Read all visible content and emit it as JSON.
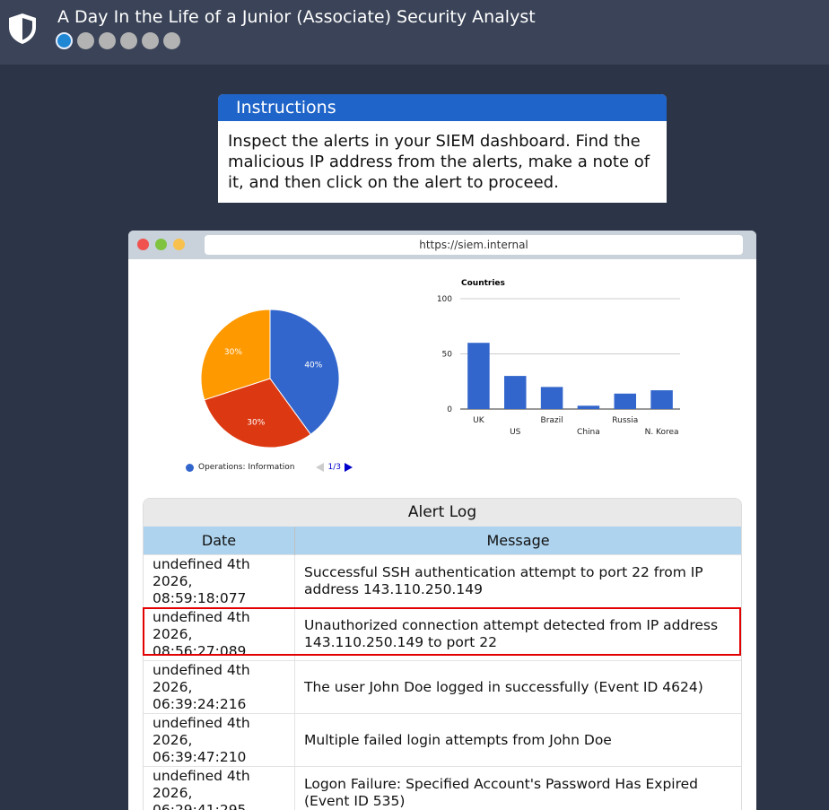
{
  "header": {
    "title": "A Day In the Life of a Junior (Associate) Security Analyst",
    "logo_icon": "shield-icon",
    "progress": {
      "total_steps": 6,
      "current_step": 1
    }
  },
  "instructions": {
    "heading": "Instructions",
    "body": "Inspect the alerts in your SIEM dashboard. Find the malicious IP address from the alerts, make a note of it, and then click on the alert to proceed."
  },
  "browser": {
    "url": "https://siem.internal"
  },
  "chart_data": [
    {
      "type": "pie",
      "slices": [
        {
          "label": "40%",
          "value": 40,
          "color": "#3366cc"
        },
        {
          "label": "30%",
          "value": 30,
          "color": "#dc3912"
        },
        {
          "label": "30%",
          "value": 30,
          "color": "#ff9900"
        }
      ],
      "legend": {
        "entry": "Operations: Information",
        "page": "1/3",
        "placement": "bottom"
      }
    },
    {
      "type": "bar",
      "title": "Countries",
      "categories": [
        "UK",
        "US",
        "Brazil",
        "China",
        "Russia",
        "N. Korea"
      ],
      "values": [
        60,
        30,
        20,
        3,
        14,
        17
      ],
      "ylim": [
        0,
        100
      ],
      "yticks": [
        "0",
        "50",
        "100"
      ],
      "grid": true,
      "color": "#3366cc"
    }
  ],
  "alert_log": {
    "title": "Alert Log",
    "columns": [
      "Date",
      "Message"
    ],
    "rows": [
      {
        "date": "undefined 4th 2026, 08:59:18:077",
        "message": "Successful SSH authentication attempt to port 22 from IP address 143.110.250.149"
      },
      {
        "date": "undefined 4th 2026, 08:56:27:089",
        "message": "Unauthorized connection attempt detected from IP address 143.110.250.149 to port 22"
      },
      {
        "date": "undefined 4th 2026, 06:39:24:216",
        "message": "The user John Doe logged in successfully (Event ID 4624)"
      },
      {
        "date": "undefined 4th 2026, 06:39:47:210",
        "message": "Multiple failed login attempts from John Doe"
      },
      {
        "date": "undefined 4th 2026, 06:29:41:295",
        "message": "Logon Failure: Specified Account's Password Has Expired (Event ID 535)"
      }
    ],
    "highlight_color": "#e30000"
  }
}
